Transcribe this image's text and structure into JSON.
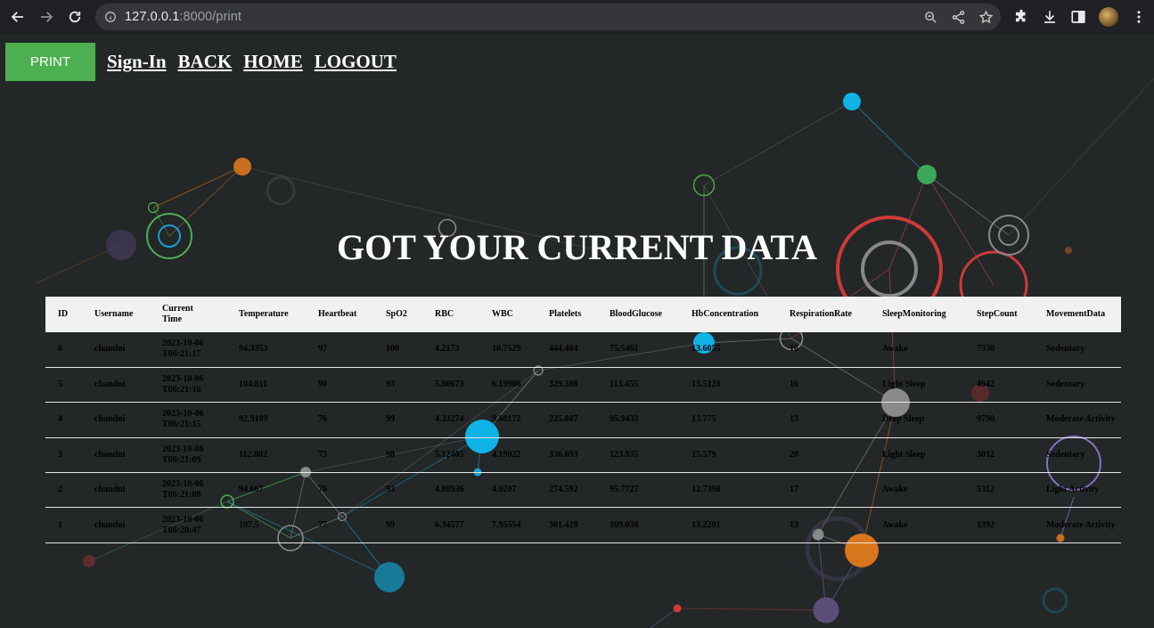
{
  "browser": {
    "url_host": "127.0.0.1",
    "url_rest": ":8000/print"
  },
  "nav": {
    "print_label": "PRINT",
    "links": [
      "Sign-In",
      "BACK",
      "HOME",
      "LOGOUT"
    ]
  },
  "page_title": "GOT YOUR CURRENT DATA",
  "table": {
    "headers": [
      "ID",
      "Username",
      "Current Time",
      "Temperature",
      "Heartbeat",
      "SpO2",
      "RBC",
      "WBC",
      "Platelets",
      "BloodGlucose",
      "HbConcentration",
      "RespirationRate",
      "SleepMonitoring",
      "StepCount",
      "MovementData"
    ],
    "rows": [
      [
        "6",
        "chandni",
        "2023-10-06T06:21:17",
        "94.3353",
        "97",
        "100",
        "4.2173",
        "10.7529",
        "444.404",
        "75.5461",
        "13.6055",
        "16",
        "Awake",
        "7330",
        "Sedentary"
      ],
      [
        "5",
        "chandni",
        "2023-10-06T06:21:16",
        "104.811",
        "90",
        "93",
        "5.86673",
        "6.19906",
        "329.388",
        "113.455",
        "13.5128",
        "16",
        "Light Sleep",
        "4642",
        "Sedentary"
      ],
      [
        "4",
        "chandni",
        "2023-10-06T06:21:15",
        "92.9109",
        "76",
        "99",
        "4.33274",
        "9.60172",
        "225.807",
        "95.9433",
        "13.775",
        "13",
        "Deep Sleep",
        "9790",
        "Moderate Activity"
      ],
      [
        "3",
        "chandni",
        "2023-10-06T06:21:09",
        "112.802",
        "73",
        "98",
        "5.12405",
        "4.19022",
        "336.693",
        "123.935",
        "15.579",
        "20",
        "Light Sleep",
        "3012",
        "Sedentary"
      ],
      [
        "2",
        "chandni",
        "2023-10-06T06:21:08",
        "94.667",
        "76",
        "93",
        "4.80936",
        "4.0207",
        "274.592",
        "95.7727",
        "12.7398",
        "17",
        "Awake",
        "5312",
        "Light Activity"
      ],
      [
        "1",
        "chandni",
        "2023-10-06T06:20:47",
        "107.5",
        "77",
        "99",
        "6.34577",
        "7.95554",
        "301.428",
        "109.038",
        "13.2201",
        "13",
        "Awake",
        "1392",
        "Moderate Activity"
      ]
    ]
  },
  "colors": {
    "print_button": "#4caf50",
    "page_background": "#232728",
    "table_header": "#f1f1f1"
  }
}
